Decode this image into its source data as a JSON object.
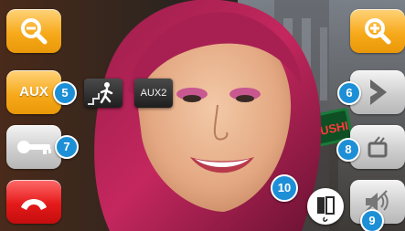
{
  "left_panel": {
    "zoom_out": {
      "icon": "zoom-out-icon",
      "color": "#f5a623"
    },
    "aux": {
      "label": "AUX",
      "badge": "5",
      "color": "#f5a623"
    },
    "key": {
      "icon": "key-icon",
      "badge": "7"
    },
    "hangup": {
      "icon": "hangup-phone-icon",
      "color": "#e11b1b"
    }
  },
  "overlay": {
    "stairs_light": {
      "icon": "stairs-light-icon"
    },
    "aux2": {
      "label": "AUX2"
    },
    "door": {
      "icon": "door-icon",
      "badge": "10"
    }
  },
  "right_panel": {
    "zoom_in": {
      "icon": "zoom-in-icon",
      "color": "#f5a623"
    },
    "next": {
      "icon": "chevron-right-icon",
      "badge": "6"
    },
    "tv": {
      "icon": "tv-icon",
      "badge": "8"
    },
    "volume": {
      "icon": "volume-muted-icon",
      "badge": "9"
    }
  },
  "video": {
    "sign_text": "SUSHI"
  }
}
